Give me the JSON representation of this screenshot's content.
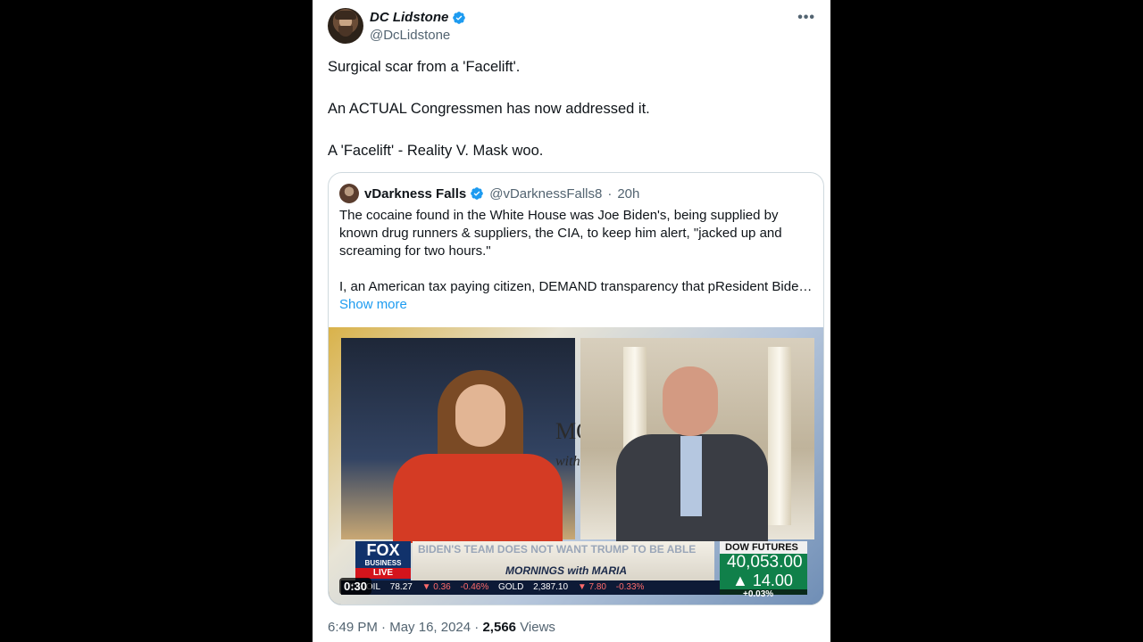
{
  "author": {
    "display_name": "DC Lidstone",
    "handle": "@DcLidstone"
  },
  "tweet_lines": [
    "Surgical scar from a 'Facelift'.",
    "An ACTUAL Congressmen has now addressed it.",
    "A 'Facelift' - Reality V. Mask woo."
  ],
  "quote": {
    "display_name": "vDarkness Falls",
    "handle": "@vDarknessFalls8",
    "time_sep": "·",
    "time": "20h",
    "body_1": "The cocaine found in the White House was Joe Biden's, being supplied by known drug runners & suppliers, the CIA, to keep him alert, \"jacked up and screaming for two hours.\"",
    "body_2": "I, an American tax paying citizen, DEMAND transparency that pResident Biden…",
    "show_more": "Show more"
  },
  "video": {
    "duration": "0:30",
    "show_title": "MOR",
    "show_sub": "with M",
    "network_1": "FOX",
    "network_2": "BUSINESS",
    "live": "LIVE",
    "headline": "BIDEN'S TEAM DOES NOT WANT TRUMP TO BE ABLE",
    "program": "MORNINGS with MARIA",
    "dow_label": "DOW FUTURES",
    "dow_value": "40,053.00",
    "dow_change": "▲ 14.00",
    "dow_pct": "+0.03%",
    "ticker": [
      "UDE OIL",
      "78.27",
      "▼ 0.36",
      "-0.46%",
      "GOLD",
      "2,387.10",
      "▼ 7.80",
      "-0.33%"
    ]
  },
  "meta": {
    "time": "6:49 PM",
    "sep": "·",
    "date": "May 16, 2024",
    "views_count": "2,566",
    "views_label": "Views"
  },
  "colors": {
    "verified": "#1d9bf0",
    "link": "#1d9bf0",
    "text": "#0f1419",
    "secondary": "#536471"
  }
}
